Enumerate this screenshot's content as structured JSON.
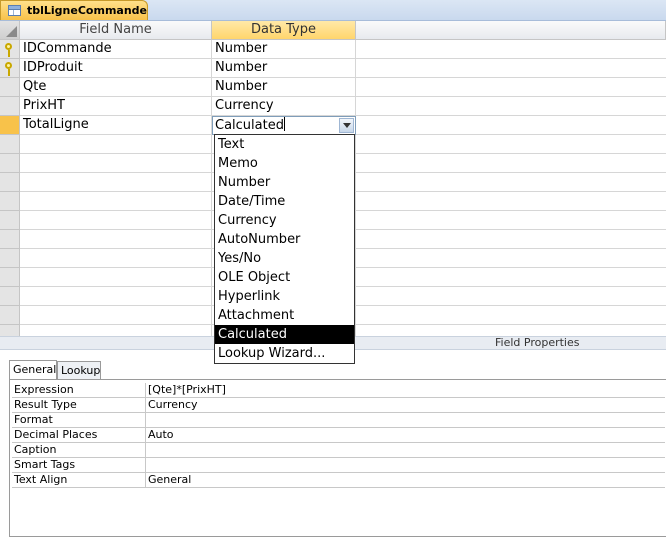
{
  "tab": {
    "title": "tblLigneCommande",
    "icon": "table-icon"
  },
  "grid": {
    "headers": {
      "field_name": "Field Name",
      "data_type": "Data Type"
    },
    "rows": [
      {
        "name": "IDCommande",
        "type": "Number",
        "key": true
      },
      {
        "name": "IDProduit",
        "type": "Number",
        "key": true
      },
      {
        "name": "Qte",
        "type": "Number",
        "key": false
      },
      {
        "name": "PrixHT",
        "type": "Currency",
        "key": false
      },
      {
        "name": "TotalLigne",
        "type": "Calculated",
        "key": false,
        "active": true
      }
    ]
  },
  "dropdown": {
    "options": [
      "Text",
      "Memo",
      "Number",
      "Date/Time",
      "Currency",
      "AutoNumber",
      "Yes/No",
      "OLE Object",
      "Hyperlink",
      "Attachment",
      "Calculated",
      "Lookup Wizard..."
    ],
    "selected": "Calculated"
  },
  "field_properties": {
    "title": "Field Properties",
    "tabs": [
      "General",
      "Lookup"
    ],
    "rows": [
      {
        "label": "Expression",
        "value": "[Qte]*[PrixHT]"
      },
      {
        "label": "Result Type",
        "value": "Currency"
      },
      {
        "label": "Format",
        "value": ""
      },
      {
        "label": "Decimal Places",
        "value": "Auto"
      },
      {
        "label": "Caption",
        "value": ""
      },
      {
        "label": "Smart Tags",
        "value": ""
      },
      {
        "label": "Text Align",
        "value": "General"
      }
    ]
  },
  "colors": {
    "accent": "#f8c24a",
    "header_active": "#ffd56c",
    "selection": "#000000"
  }
}
